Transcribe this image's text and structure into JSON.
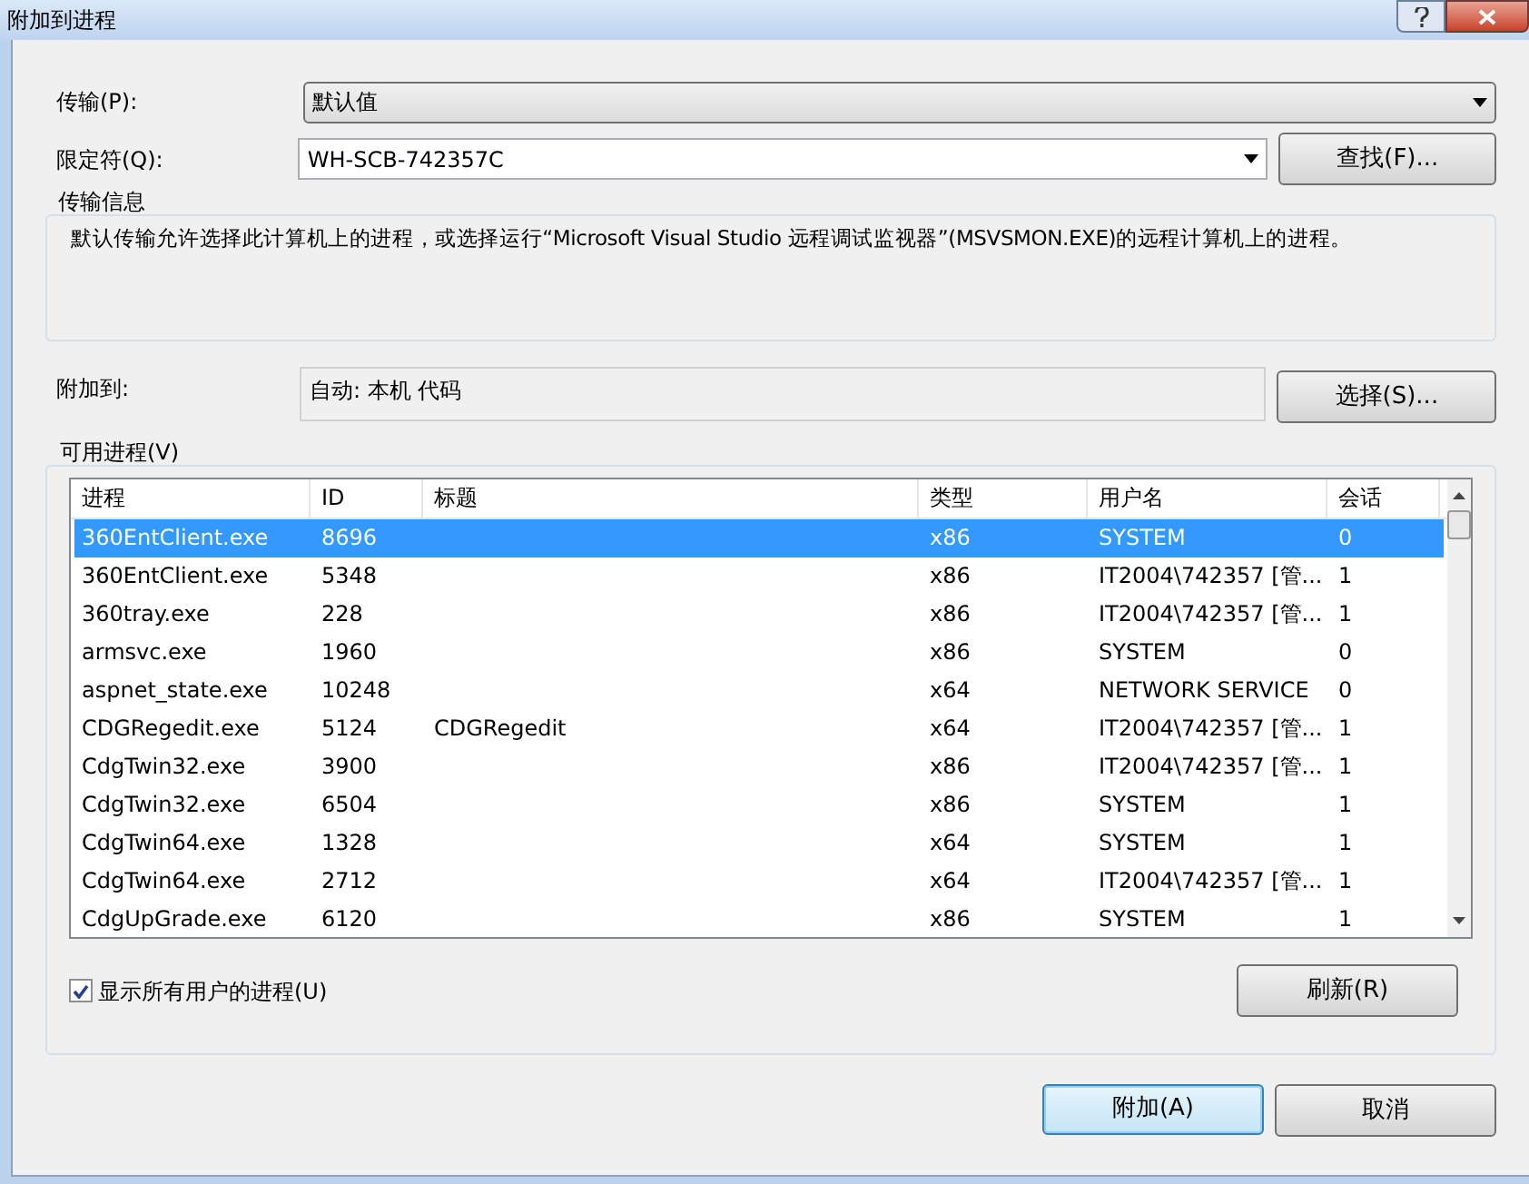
{
  "window": {
    "title": "附加到进程"
  },
  "transport": {
    "label": "传输(P):",
    "value": "默认值"
  },
  "qualifier": {
    "label": "限定符(Q):",
    "value": "WH-SCB-742357C",
    "button": "查找(F)..."
  },
  "transport_info": {
    "title": "传输信息",
    "text": "默认传输允许选择此计算机上的进程，或选择运行“Microsoft Visual Studio 远程调试监视器”(MSVSMON.EXE)的远程计算机上的进程。"
  },
  "attach_to": {
    "label": "附加到:",
    "value": "自动: 本机 代码",
    "button": "选择(S)..."
  },
  "processes": {
    "title": "可用进程(V)",
    "columns": [
      "进程",
      "ID",
      "标题",
      "类型",
      "用户名",
      "会话"
    ],
    "rows": [
      {
        "cells": [
          "360EntClient.exe",
          "8696",
          "",
          "x86",
          "SYSTEM",
          "0"
        ],
        "selected": true
      },
      {
        "cells": [
          "360EntClient.exe",
          "5348",
          "",
          "x86",
          "IT2004\\742357 [管...",
          "1"
        ],
        "selected": false
      },
      {
        "cells": [
          "360tray.exe",
          "228",
          "",
          "x86",
          "IT2004\\742357 [管...",
          "1"
        ],
        "selected": false
      },
      {
        "cells": [
          "armsvc.exe",
          "1960",
          "",
          "x86",
          "SYSTEM",
          "0"
        ],
        "selected": false
      },
      {
        "cells": [
          "aspnet_state.exe",
          "10248",
          "",
          "x64",
          "NETWORK SERVICE",
          "0"
        ],
        "selected": false
      },
      {
        "cells": [
          "CDGRegedit.exe",
          "5124",
          "CDGRegedit",
          "x64",
          "IT2004\\742357 [管...",
          "1"
        ],
        "selected": false
      },
      {
        "cells": [
          "CdgTwin32.exe",
          "3900",
          "",
          "x86",
          "IT2004\\742357 [管...",
          "1"
        ],
        "selected": false
      },
      {
        "cells": [
          "CdgTwin32.exe",
          "6504",
          "",
          "x86",
          "SYSTEM",
          "1"
        ],
        "selected": false
      },
      {
        "cells": [
          "CdgTwin64.exe",
          "1328",
          "",
          "x64",
          "SYSTEM",
          "1"
        ],
        "selected": false
      },
      {
        "cells": [
          "CdgTwin64.exe",
          "2712",
          "",
          "x64",
          "IT2004\\742357 [管...",
          "1"
        ],
        "selected": false
      },
      {
        "cells": [
          "CdgUpGrade.exe",
          "6120",
          "",
          "x86",
          "SYSTEM",
          "1"
        ],
        "selected": false
      }
    ],
    "show_all_users": {
      "label": "显示所有用户的进程(U)",
      "checked": true
    },
    "refresh": "刷新(R)"
  },
  "buttons": [
    {
      "label": "附加(A)",
      "kind": "default"
    },
    {
      "label": "取消",
      "kind": "normal"
    }
  ]
}
